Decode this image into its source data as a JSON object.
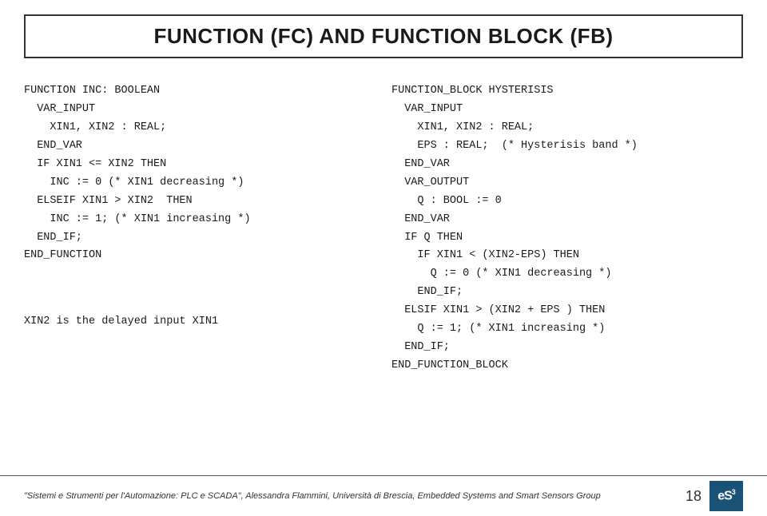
{
  "title": "FUNCTION (FC) AND FUNCTION BLOCK (FB)",
  "left_column": {
    "code_lines": [
      "FUNCTION INC: BOOLEAN",
      "  VAR_INPUT",
      "    XIN1, XIN2 : REAL;",
      "  END_VAR",
      "  IF XIN1 <= XIN2 THEN",
      "    INC := 0 (* XIN1 decreasing *)",
      "  ELSEIF XIN1 > XIN2  THEN",
      "    INC := 1; (* XIN1 increasing *)",
      "  END_IF;",
      "END_FUNCTION"
    ],
    "note": "  XIN2 is the delayed input XIN1"
  },
  "right_column": {
    "code_lines": [
      "FUNCTION_BLOCK HYSTERISIS",
      "  VAR_INPUT",
      "    XIN1, XIN2 : REAL;",
      "    EPS : REAL;  (* Hysterisis band *)",
      "  END_VAR",
      "  VAR_OUTPUT",
      "    Q : BOOL := 0",
      "  END_VAR",
      "  IF Q THEN",
      "    IF XIN1 < (XIN2-EPS) THEN",
      "      Q := 0 (* XIN1 decreasing *)",
      "    END_IF;",
      "  ELSIF XIN1 > (XIN2 + EPS ) THEN",
      "    Q := 1; (* XIN1 increasing *)",
      "  END_IF;",
      "END_FUNCTION_BLOCK"
    ]
  },
  "footer": {
    "text": "\"Sistemi e Strumenti per l'Automazione: PLC e SCADA\", Alessandra Flammini, Università di Brescia, Embedded Systems and Smart Sensors Group",
    "page_number": "18",
    "logo_text": "eS",
    "logo_superscript": "3"
  }
}
